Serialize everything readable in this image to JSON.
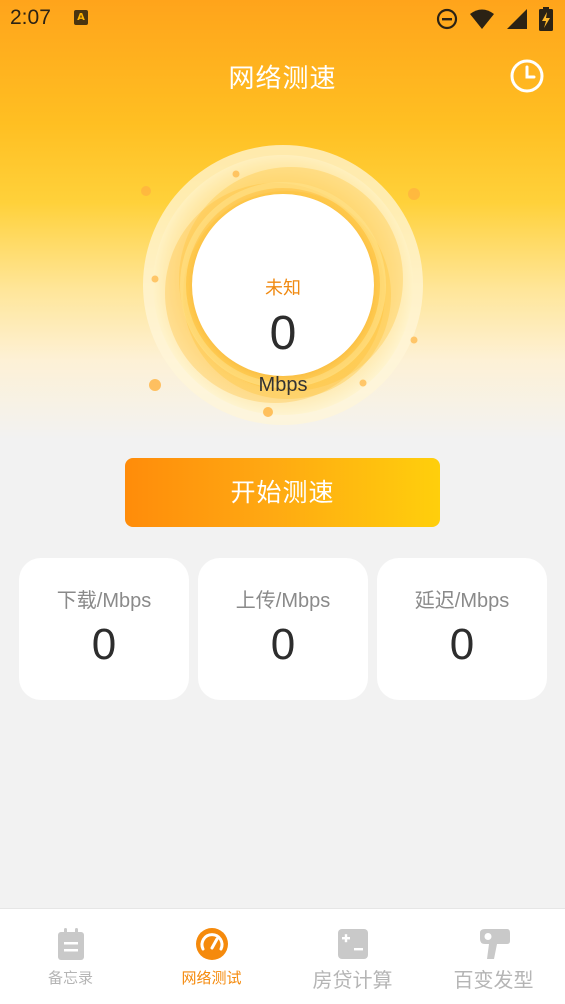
{
  "status_bar": {
    "time": "2:07",
    "notification_icon": "a-letter-icon",
    "icons": [
      "dnd-icon",
      "wifi-icon",
      "signal-icon",
      "battery-charging-icon"
    ]
  },
  "header": {
    "title": "网络测速",
    "history_icon": "clock-icon"
  },
  "gauge": {
    "status": "未知",
    "value": "0",
    "unit": "Mbps"
  },
  "start_button": {
    "label": "开始测速"
  },
  "stats": [
    {
      "label": "下载/Mbps",
      "value": "0"
    },
    {
      "label": "上传/Mbps",
      "value": "0"
    },
    {
      "label": "延迟/Mbps",
      "value": "0"
    }
  ],
  "bottom_nav": {
    "items": [
      {
        "label": "备忘录",
        "icon": "notepad-icon",
        "active": false
      },
      {
        "label": "网络测试",
        "icon": "speedometer-icon",
        "active": true
      },
      {
        "label": "房贷计算",
        "icon": "calculator-icon",
        "active": false
      },
      {
        "label": "百变发型",
        "icon": "hair-dryer-icon",
        "active": false
      }
    ]
  },
  "colors": {
    "accent": "#f58a0c",
    "inactive": "#b5b5b5",
    "header_gradient_top": "#ffa41b",
    "header_gradient_mid": "#ffd13a"
  }
}
